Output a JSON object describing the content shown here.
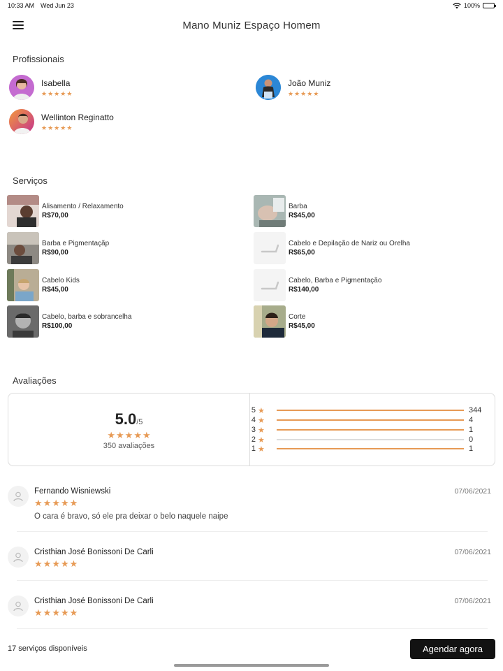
{
  "status": {
    "time": "10:33 AM",
    "date": "Wed Jun 23",
    "battery": "100%"
  },
  "header": {
    "title": "Mano Muniz Espaço Homem"
  },
  "sections": {
    "professionals": "Profissionais",
    "services": "Serviços",
    "reviews": "Avaliações"
  },
  "professionals": [
    {
      "name": "Isabella",
      "rating": 5,
      "avatar_color": "#c46bd0"
    },
    {
      "name": "João Muniz",
      "rating": 5,
      "avatar_color": "#2b87d6"
    },
    {
      "name": "Wellinton Reginatto",
      "rating": 5,
      "avatar_color": "#e05a6a"
    }
  ],
  "services": [
    {
      "name": "Alisamento / Relaxamento",
      "price": "R$70,00",
      "has_image": true,
      "thumb_color": "#7d5b55"
    },
    {
      "name": "Barba",
      "price": "R$45,00",
      "has_image": true,
      "thumb_color": "#8fa39e"
    },
    {
      "name": "Barba e  Pigmentaçãp",
      "price": "R$90,00",
      "has_image": true,
      "thumb_color": "#6d6a66"
    },
    {
      "name": "Cabelo e Depilação de Nariz ou Orelha",
      "price": "R$65,00",
      "has_image": false,
      "thumb_color": "#f4f4f4"
    },
    {
      "name": "Cabelo Kids",
      "price": "R$45,00",
      "has_image": true,
      "thumb_color": "#8a7f6c"
    },
    {
      "name": "Cabelo, Barba e Pigmentação",
      "price": "R$140,00",
      "has_image": false,
      "thumb_color": "#f4f4f4"
    },
    {
      "name": "Cabelo, barba e sobrancelha",
      "price": "R$100,00",
      "has_image": true,
      "thumb_color": "#555555"
    },
    {
      "name": "Corte",
      "price": "R$45,00",
      "has_image": true,
      "thumb_color": "#5e6b4e"
    }
  ],
  "ratings": {
    "score": "5.0",
    "out_of": "/5",
    "count_label": "350 avaliações",
    "rows": [
      {
        "star": "5",
        "count": "344",
        "fraction": 1.0
      },
      {
        "star": "4",
        "count": "4",
        "fraction": 1.0
      },
      {
        "star": "3",
        "count": "1",
        "fraction": 1.0
      },
      {
        "star": "2",
        "count": "0",
        "fraction": 0
      },
      {
        "star": "1",
        "count": "1",
        "fraction": 1.0
      }
    ]
  },
  "reviews": [
    {
      "name": "Fernando Wisniewski",
      "date": "07/06/2021",
      "rating": 5,
      "text": "O cara é bravo, só ele pra deixar o belo naquele naipe"
    },
    {
      "name": "Cristhian José Bonissoni De Carli",
      "date": "07/06/2021",
      "rating": 5,
      "text": ""
    },
    {
      "name": "Cristhian José Bonissoni De Carli",
      "date": "07/06/2021",
      "rating": 5,
      "text": ""
    }
  ],
  "footer": {
    "services_available": "17 serviços disponíveis",
    "book_label": "Agendar agora"
  },
  "colors": {
    "accent_star": "#e79a55",
    "button_bg": "#121212"
  }
}
